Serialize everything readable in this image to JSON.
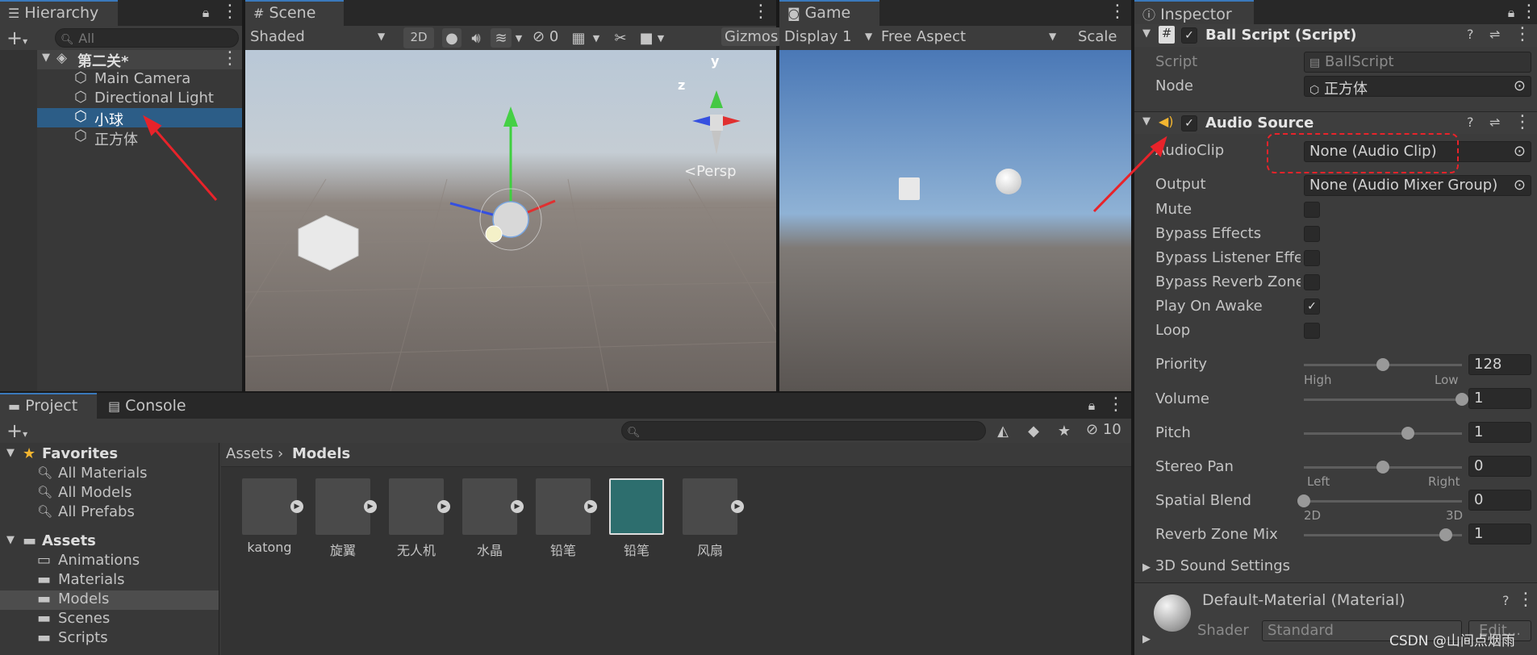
{
  "hierarchy": {
    "tab_label": "Hierarchy",
    "search_placeholder": "All",
    "scene_name": "第二关*",
    "items": [
      "Main Camera",
      "Directional Light",
      "小球",
      "正方体"
    ],
    "selected_index": 2
  },
  "scene": {
    "tab_label": "Scene",
    "shading_mode": "Shaded",
    "mode_2d": "2D",
    "hidden_count": "0",
    "gizmos_label": "Gizmos",
    "persp_label": "Persp",
    "gizmo_y": "y",
    "gizmo_z": "z"
  },
  "game": {
    "tab_label": "Game",
    "display": "Display 1",
    "aspect": "Free Aspect",
    "scale_label": "Scale"
  },
  "inspector": {
    "tab_label": "Inspector",
    "ball_script": {
      "title": "Ball Script (Script)",
      "script_label": "Script",
      "script_value": "BallScript",
      "node_label": "Node",
      "node_value": "正方体"
    },
    "audio_source": {
      "title": "Audio Source",
      "audioclip_label": "AudioClip",
      "audioclip_value": "None (Audio Clip)",
      "output_label": "Output",
      "output_value": "None (Audio Mixer Group)",
      "toggles": [
        {
          "label": "Mute",
          "checked": false
        },
        {
          "label": "Bypass Effects",
          "checked": false
        },
        {
          "label": "Bypass Listener Effe",
          "checked": false
        },
        {
          "label": "Bypass Reverb Zone",
          "checked": false
        },
        {
          "label": "Play On Awake",
          "checked": true
        },
        {
          "label": "Loop",
          "checked": false
        }
      ],
      "priority": {
        "label": "Priority",
        "value": "128",
        "low_label": "High",
        "high_label": "Low",
        "fraction": 0.5
      },
      "volume": {
        "label": "Volume",
        "value": "1",
        "fraction": 1.0
      },
      "pitch": {
        "label": "Pitch",
        "value": "1",
        "fraction": 0.66
      },
      "stereo_pan": {
        "label": "Stereo Pan",
        "value": "0",
        "low_label": "Left",
        "high_label": "Right",
        "fraction": 0.5
      },
      "spatial_blend": {
        "label": "Spatial Blend",
        "value": "0",
        "low_label": "2D",
        "high_label": "3D",
        "fraction": 0.0
      },
      "reverb_zone_mix": {
        "label": "Reverb Zone Mix",
        "value": "1",
        "fraction": 0.9
      },
      "sound_3d": "3D Sound Settings"
    },
    "material": {
      "title": "Default-Material (Material)",
      "shader_label": "Shader",
      "shader_value": "Standard",
      "edit_label": "Edit..."
    }
  },
  "project": {
    "tab_label": "Project",
    "console_tab_label": "Console",
    "hidden_count": "10",
    "favorites_label": "Favorites",
    "favorites": [
      "All Materials",
      "All Models",
      "All Prefabs"
    ],
    "assets_label": "Assets",
    "folders": [
      "Animations",
      "Materials",
      "Models",
      "Scenes",
      "Scripts"
    ],
    "selected_folder_index": 2,
    "breadcrumb_root": "Assets",
    "breadcrumb_current": "Models",
    "tiles": [
      "katong",
      "旋翼",
      "无人机",
      "水晶",
      "铅笔",
      "铅笔",
      "风扇"
    ]
  },
  "watermark": "CSDN @山间点烟雨",
  "colors": {
    "selection": "#2c5d87",
    "annotation_red": "#e8232a",
    "accent_blue": "#3a79bb"
  }
}
